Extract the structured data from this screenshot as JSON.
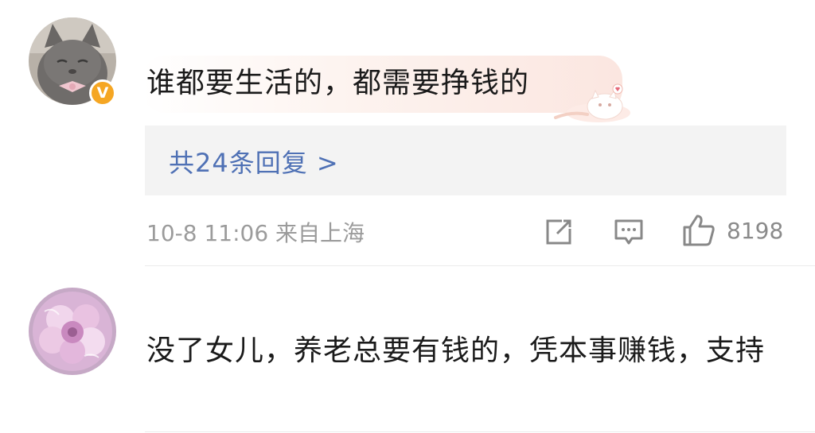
{
  "comments": [
    {
      "text": "谁都要生活的，都需要挣钱的",
      "verified_badge": "V",
      "replies_label": "共24条回复 >",
      "timestamp": "10-8 11:06",
      "location": "来自上海",
      "like_count": "8198",
      "avatar_icon": "cat-avatar-icon"
    },
    {
      "text": "没了女儿，养老总要有钱的，凭本事赚钱，支持",
      "avatar_icon": "flower-avatar-icon"
    }
  ],
  "colors": {
    "link": "#4f71b5",
    "badge": "#f5a623",
    "meta_text": "#9b9b9b",
    "reply_box": "#f3f3f3"
  }
}
